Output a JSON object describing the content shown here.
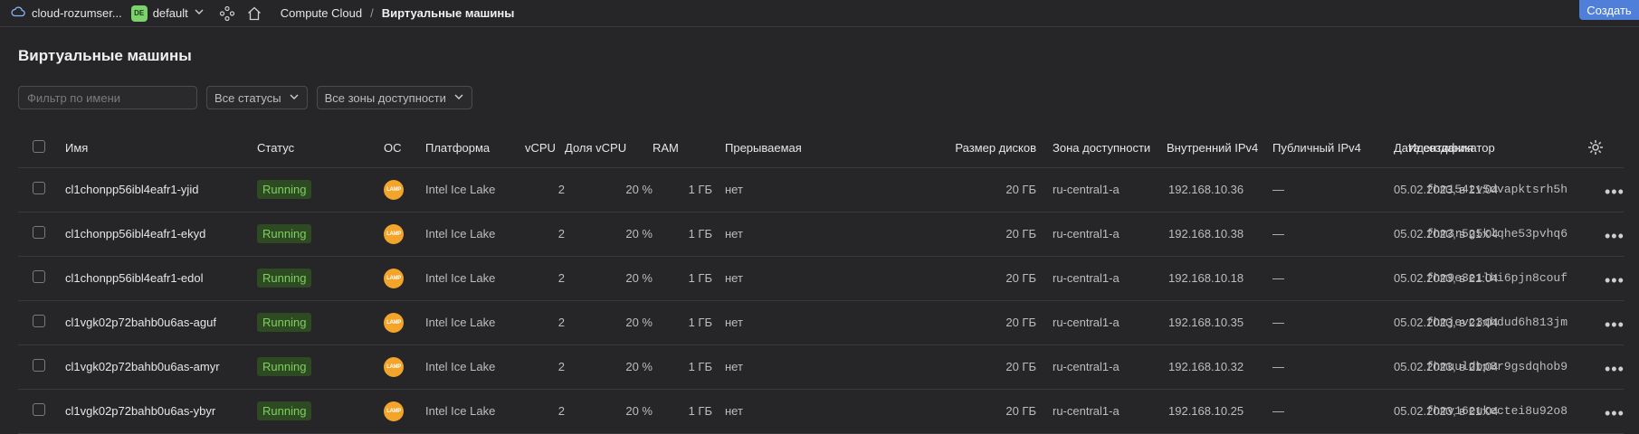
{
  "topbar": {
    "cloud_name": "cloud-rozumser...",
    "folder_badge": "DE",
    "folder_name": "default",
    "breadcrumb": [
      "Compute Cloud",
      "Виртуальные машины"
    ],
    "separator": "/",
    "create_label": "Создать"
  },
  "page": {
    "title": "Виртуальные машины",
    "filter_placeholder": "Фильтр по имени",
    "status_select": "Все статусы",
    "zone_select": "Все зоны доступности"
  },
  "table": {
    "headers": {
      "name": "Имя",
      "status": "Статус",
      "os": "ОС",
      "platform": "Платформа",
      "vcpu": "vCPU",
      "vcpu_share": "Доля vCPU",
      "ram": "RAM",
      "preemptible": "Прерываемая",
      "disk_size": "Размер дисков",
      "zone": "Зона доступности",
      "internal_ip": "Внутренний IPv4",
      "public_ip": "Публичный IPv4",
      "created": "Дата создания",
      "id": "Идентификатор"
    },
    "os_label": "LAMP",
    "rows": [
      {
        "name": "cl1chonpp56ibl4eafr1-yjid",
        "status": "Running",
        "platform": "Intel Ice Lake",
        "vcpu": "2",
        "vcpu_share": "20 %",
        "ram": "1 ГБ",
        "preemptible": "нет",
        "disk": "20 ГБ",
        "zone": "ru-central1-a",
        "internal_ip": "192.168.10.36",
        "public_ip": "—",
        "created": "05.02.2023, в 21:04",
        "id": "fhm154tv5dvapktsrh5h"
      },
      {
        "name": "cl1chonpp56ibl4eafr1-ekyd",
        "status": "Running",
        "platform": "Intel Ice Lake",
        "vcpu": "2",
        "vcpu_share": "20 %",
        "ram": "1 ГБ",
        "preemptible": "нет",
        "disk": "20 ГБ",
        "zone": "ru-central1-a",
        "internal_ip": "192.168.10.38",
        "public_ip": "—",
        "created": "05.02.2023, в 21:04",
        "id": "fhm3r5g5klqhe53pvhq6"
      },
      {
        "name": "cl1chonpp56ibl4eafr1-edol",
        "status": "Running",
        "platform": "Intel Ice Lake",
        "vcpu": "2",
        "vcpu_share": "20 %",
        "ram": "1 ГБ",
        "preemptible": "нет",
        "disk": "20 ГБ",
        "zone": "ru-central1-a",
        "internal_ip": "192.168.10.18",
        "public_ip": "—",
        "created": "05.02.2023, в 21:04",
        "id": "fhm9e3e1lhi6pjn8couf"
      },
      {
        "name": "cl1vgk02p72bahb0u6as-aguf",
        "status": "Running",
        "platform": "Intel Ice Lake",
        "vcpu": "2",
        "vcpu_share": "20 %",
        "ram": "1 ГБ",
        "preemptible": "нет",
        "disk": "20 ГБ",
        "zone": "ru-central1-a",
        "internal_ip": "192.168.10.35",
        "public_ip": "—",
        "created": "05.02.2023, в 21:04",
        "id": "fhmjevc3qhdud6h813jm"
      },
      {
        "name": "cl1vgk02p72bahb0u6as-amyr",
        "status": "Running",
        "platform": "Intel Ice Lake",
        "vcpu": "2",
        "vcpu_share": "20 %",
        "ram": "1 ГБ",
        "preemptible": "нет",
        "disk": "20 ГБ",
        "zone": "ru-central1-a",
        "internal_ip": "192.168.10.32",
        "public_ip": "—",
        "created": "05.02.2023, в 21:04",
        "id": "fhmuuldbp8r9gsdqhob9"
      },
      {
        "name": "cl1vgk02p72bahb0u6as-ybyr",
        "status": "Running",
        "platform": "Intel Ice Lake",
        "vcpu": "2",
        "vcpu_share": "20 %",
        "ram": "1 ГБ",
        "preemptible": "нет",
        "disk": "20 ГБ",
        "zone": "ru-central1-a",
        "internal_ip": "192.168.10.25",
        "public_ip": "—",
        "created": "05.02.2023, в 21:04",
        "id": "fhmv16eukectei8u92o8"
      }
    ]
  }
}
